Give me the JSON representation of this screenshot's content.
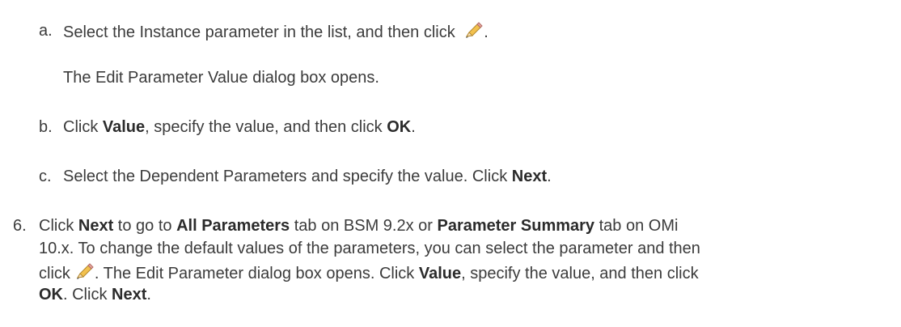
{
  "steps": {
    "a": {
      "marker": "a.",
      "text1": "Select the Instance parameter in the list, and then click",
      "text2": "."
    },
    "a_note": "The Edit Parameter Value dialog box opens.",
    "b": {
      "marker": "b.",
      "t1": "Click ",
      "b1": "Value",
      "t2": ", specify the value, and then click ",
      "b2": "OK",
      "t3": "."
    },
    "c": {
      "marker": "c.",
      "t1": "Select the Dependent Parameters and specify the value. Click ",
      "b1": "Next",
      "t2": "."
    },
    "six": {
      "marker": "6.",
      "l1_t1": "Click ",
      "l1_b1": "Next",
      "l1_t2": " to go to ",
      "l1_b2": "All Parameters",
      "l1_t3": " tab on BSM 9.2x or ",
      "l1_b3": "Parameter Summary",
      "l1_t4": " tab on OMi",
      "l2": "10.x. To change the default values of the parameters, you can select the parameter and then",
      "l3_t1": "click",
      "l3_t2": ". The Edit Parameter dialog box opens. Click ",
      "l3_b1": "Value",
      "l3_t3": ", specify the value, and then click",
      "l4_b1": "OK",
      "l4_t1": ". Click ",
      "l4_b2": "Next",
      "l4_t2": "."
    }
  },
  "icons": {
    "edit": "pencil-icon"
  },
  "colors": {
    "text": "#3b3b3b",
    "pencil_body": "#f2c14e",
    "pencil_tip": "#e7a7a0"
  }
}
